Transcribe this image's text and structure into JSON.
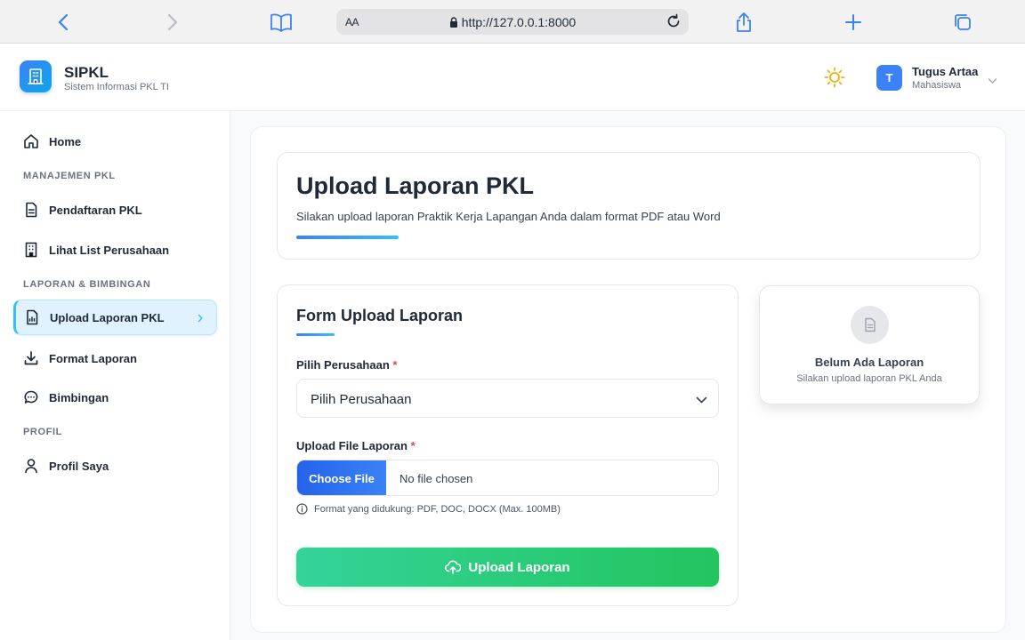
{
  "browser": {
    "url": "http://127.0.0.1:8000",
    "aa_label": "AA"
  },
  "header": {
    "brand_name": "SIPKL",
    "brand_subtitle": "Sistem Informasi PKL TI",
    "user_initial": "T",
    "user_name": "Tugus Artaa",
    "user_role": "Mahasiswa"
  },
  "sidebar": {
    "home": "Home",
    "sections": [
      "MANAJEMEN PKL",
      "LAPORAN & BIMBINGAN",
      "PROFIL"
    ],
    "items": [
      {
        "label": "Pendaftaran PKL",
        "icon": "document-icon"
      },
      {
        "label": "Lihat List Perusahaan",
        "icon": "building-icon"
      },
      {
        "label": "Upload Laporan PKL",
        "icon": "report-icon",
        "active": true
      },
      {
        "label": "Format Laporan",
        "icon": "download-icon"
      },
      {
        "label": "Bimbingan",
        "icon": "chat-icon"
      },
      {
        "label": "Profil Saya",
        "icon": "user-icon"
      }
    ]
  },
  "main": {
    "title": "Upload Laporan PKL",
    "subtitle": "Silakan upload laporan Praktik Kerja Lapangan Anda dalam format PDF atau Word",
    "form": {
      "title": "Form Upload Laporan",
      "company_label": "Pilih Perusahaan",
      "company_value": "Pilih Perusahaan",
      "file_label": "Upload File Laporan",
      "file_button": "Choose File",
      "file_status": "No file chosen",
      "hint": "Format yang didukung: PDF, DOC, DOCX (Max. 100MB)",
      "submit": "Upload Laporan",
      "required_mark": "*"
    },
    "empty_state": {
      "title": "Belum Ada Laporan",
      "subtitle": "Silakan upload laporan PKL Anda"
    }
  },
  "colors": {
    "primary": "#3b82f6",
    "accent": "#38bdf8",
    "success": "#22c55e",
    "required": "#ef4444"
  }
}
